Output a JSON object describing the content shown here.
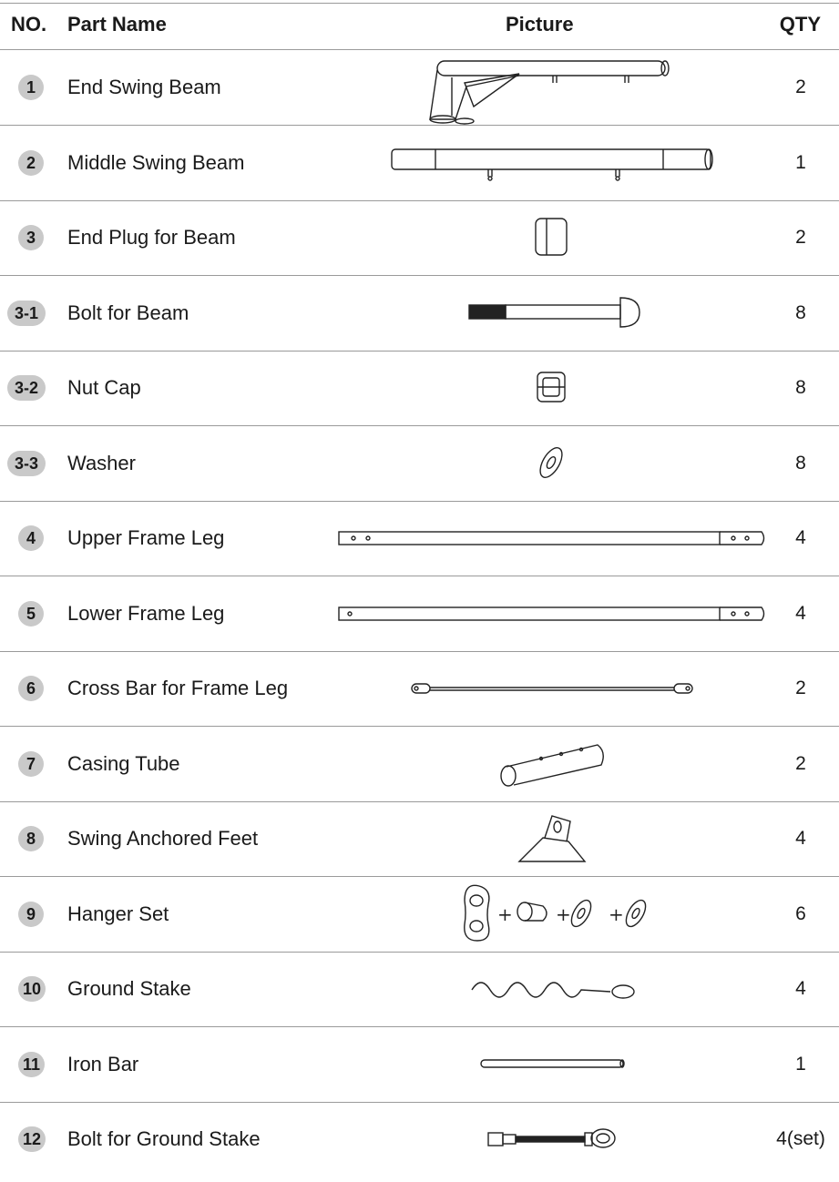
{
  "header": {
    "no": "NO.",
    "part_name": "Part Name",
    "picture": "Picture",
    "qty": "QTY"
  },
  "parts": [
    {
      "no": "1",
      "name": "End Swing Beam",
      "qty": "2",
      "icon": "end-swing-beam-icon"
    },
    {
      "no": "2",
      "name": "Middle Swing Beam",
      "qty": "1",
      "icon": "middle-swing-beam-icon"
    },
    {
      "no": "3",
      "name": "End Plug for Beam",
      "qty": "2",
      "icon": "end-plug-icon"
    },
    {
      "no": "3-1",
      "name": "Bolt for Beam",
      "qty": "8",
      "icon": "bolt-icon"
    },
    {
      "no": "3-2",
      "name": "Nut Cap",
      "qty": "8",
      "icon": "nut-cap-icon"
    },
    {
      "no": "3-3",
      "name": "Washer",
      "qty": "8",
      "icon": "washer-icon"
    },
    {
      "no": "4",
      "name": "Upper Frame Leg",
      "qty": "4",
      "icon": "upper-frame-leg-icon"
    },
    {
      "no": "5",
      "name": "Lower Frame Leg",
      "qty": "4",
      "icon": "lower-frame-leg-icon"
    },
    {
      "no": "6",
      "name": "Cross Bar for Frame Leg",
      "qty": "2",
      "icon": "cross-bar-icon"
    },
    {
      "no": "7",
      "name": "Casing Tube",
      "qty": "2",
      "icon": "casing-tube-icon"
    },
    {
      "no": "8",
      "name": "Swing Anchored Feet",
      "qty": "4",
      "icon": "anchored-feet-icon"
    },
    {
      "no": "9",
      "name": "Hanger Set",
      "qty": "6",
      "icon": "hanger-set-icon"
    },
    {
      "no": "10",
      "name": "Ground Stake",
      "qty": "4",
      "icon": "ground-stake-icon"
    },
    {
      "no": "11",
      "name": "Iron Bar",
      "qty": "1",
      "icon": "iron-bar-icon"
    },
    {
      "no": "12",
      "name": "Bolt for Ground Stake",
      "qty": "4(set)",
      "icon": "ground-stake-bolt-icon"
    }
  ],
  "hanger_set_plus": "+"
}
